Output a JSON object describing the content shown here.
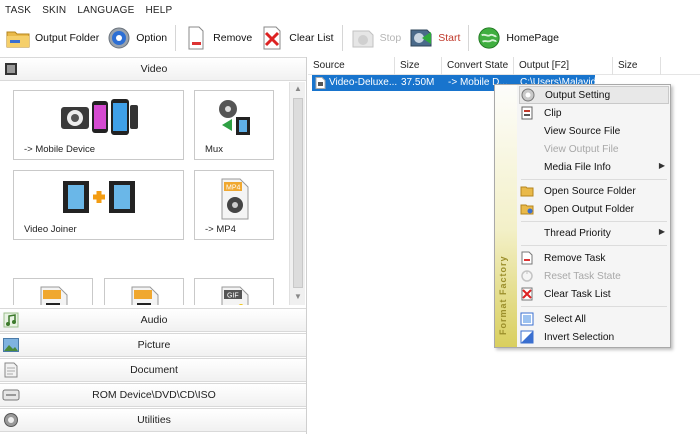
{
  "menu": [
    "TASK",
    "SKIN",
    "LANGUAGE",
    "HELP"
  ],
  "toolbar": {
    "output_folder": "Output Folder",
    "option": "Option",
    "remove": "Remove",
    "clear_list": "Clear List",
    "stop": "Stop",
    "start": "Start",
    "homepage": "HomePage"
  },
  "categories": {
    "video": "Video",
    "audio": "Audio",
    "picture": "Picture",
    "document": "Document",
    "rom": "ROM Device\\DVD\\CD\\ISO",
    "utilities": "Utilities"
  },
  "tiles": {
    "mobile": "-> Mobile Device",
    "mux": "Mux",
    "joiner": "Video Joiner",
    "mp4": "-> MP4",
    "mp4_badge": "MP4",
    "gif_badge": "GIF"
  },
  "table": {
    "headers": [
      "Source",
      "Size",
      "Convert State",
      "Output [F2]",
      "Size"
    ],
    "row": {
      "source": "Video-Deluxe...",
      "size": "37.50M",
      "state": "-> Mobile D...",
      "output": "C:\\Users\\Malavida..."
    }
  },
  "context_menu": {
    "brand": "Format Factory",
    "items": [
      "Output Setting",
      "Clip",
      "View Source File",
      "View Output File",
      "Media File Info",
      "Open Source Folder",
      "Open Output Folder",
      "Thread Priority",
      "Remove Task",
      "Reset Task State",
      "Clear Task List",
      "Select All",
      "Invert Selection"
    ]
  },
  "colors": {
    "selection": "#1874cd",
    "start_label": "#c0392b",
    "menu_band": "#d9cf5e"
  }
}
